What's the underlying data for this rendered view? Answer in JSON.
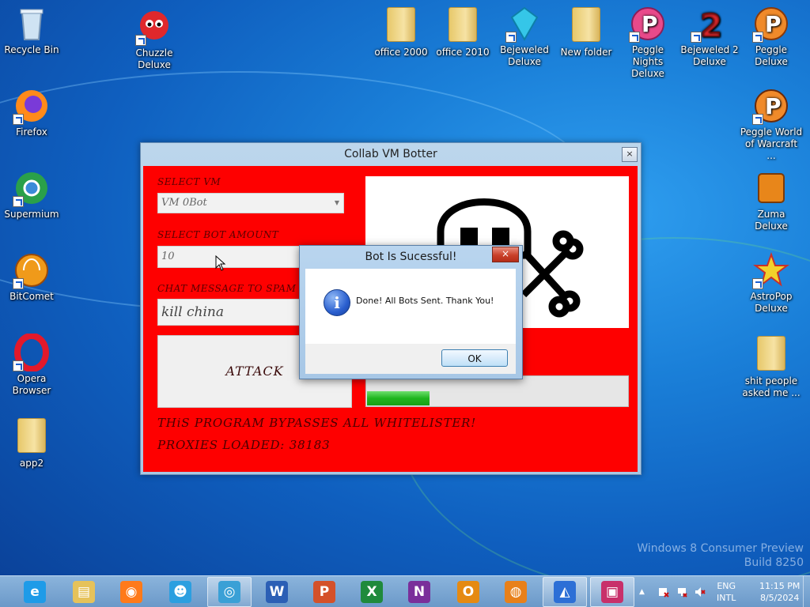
{
  "desktop": {
    "icons": [
      {
        "label": "Recycle Bin",
        "icon": "recycle-bin-icon"
      },
      {
        "label": "Chuzzle Deluxe",
        "icon": "chuzzle-icon"
      },
      {
        "label": "office 2000",
        "icon": "folder-icon"
      },
      {
        "label": "office 2010",
        "icon": "folder-icon"
      },
      {
        "label": "Bejeweled Deluxe",
        "icon": "bejeweled-icon"
      },
      {
        "label": "New folder",
        "icon": "folder-icon"
      },
      {
        "label": "Peggle Nights Deluxe",
        "icon": "peggle-nights-icon"
      },
      {
        "label": "Bejeweled 2 Deluxe",
        "icon": "bejeweled-2-icon"
      },
      {
        "label": "Peggle Deluxe",
        "icon": "peggle-icon"
      },
      {
        "label": "Firefox",
        "icon": "firefox-icon"
      },
      {
        "label": "Peggle World of Warcraft ...",
        "icon": "peggle-wow-icon"
      },
      {
        "label": "Supermium",
        "icon": "supermium-icon"
      },
      {
        "label": "Zuma Deluxe",
        "icon": "zuma-icon"
      },
      {
        "label": "BitComet",
        "icon": "bitcomet-icon"
      },
      {
        "label": "AstroPop Deluxe",
        "icon": "astropop-icon"
      },
      {
        "label": "Opera Browser",
        "icon": "opera-icon"
      },
      {
        "label": "shit people asked me ...",
        "icon": "folder-icon"
      },
      {
        "label": "app2",
        "icon": "folder-icon"
      }
    ],
    "watermark": {
      "line1": "Windows 8 Consumer Preview",
      "line2": "Build 8250"
    }
  },
  "app_window": {
    "title": "Collab VM Botter",
    "close_glyph": "×",
    "select_vm_label": "SELECT VM",
    "select_vm_value": "VM 0Bot",
    "select_bot_amount_label": "SELECT BOT AMOUNT",
    "bot_amount_value": "10",
    "chat_message_label": "CHAT MESSAGE TO SPAM",
    "chat_message_value": "kill china",
    "attack_button": "ATTACK",
    "bypass_text": "THiS PROGRAM BYPASSES ALL WHITELISTER!",
    "proxies_text": "PROXIES LOADED: 38183",
    "progress_fraction": 0.24
  },
  "dialog": {
    "title": "Bot Is Sucessful!",
    "close_glyph": "×",
    "message": "Done! All Bots Sent. Thank You!",
    "ok_button": "OK",
    "info_glyph": "i"
  },
  "taskbar": {
    "pinned": [
      {
        "name": "ie-icon",
        "glyph": "e",
        "color": "#1e9be8"
      },
      {
        "name": "explorer-icon",
        "glyph": "▤",
        "color": "#e6c25a"
      },
      {
        "name": "firefox-icon",
        "glyph": "◉",
        "color": "#ff7a1a"
      },
      {
        "name": "messenger-icon",
        "glyph": "☻",
        "color": "#2b9fe0"
      },
      {
        "name": "supermium-icon",
        "glyph": "◎",
        "color": "#3aa0d6"
      },
      {
        "name": "word-icon",
        "glyph": "W",
        "color": "#2b5fb5"
      },
      {
        "name": "powerpoint-icon",
        "glyph": "P",
        "color": "#d4512a"
      },
      {
        "name": "excel-icon",
        "glyph": "X",
        "color": "#1f8a3c"
      },
      {
        "name": "onenote-icon",
        "glyph": "N",
        "color": "#7a2f9a"
      },
      {
        "name": "outlook-icon",
        "glyph": "O",
        "color": "#e58a12"
      },
      {
        "name": "bitcomet-icon",
        "glyph": "◍",
        "color": "#e8801a"
      },
      {
        "name": "bot-app-icon",
        "glyph": "◭",
        "color": "#2c6fd6"
      },
      {
        "name": "dialog-app-icon",
        "glyph": "▣",
        "color": "#c8306a"
      }
    ],
    "language_line1": "ENG",
    "language_line2": "INTL",
    "time": "11:15 PM",
    "date": "8/5/2024",
    "show_hidden_glyph": "▲"
  }
}
